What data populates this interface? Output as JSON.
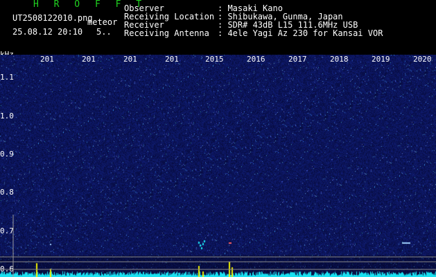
{
  "app": {
    "title": "H R O F F T",
    "filename": "UT2508122010.png",
    "mode": "meteor",
    "datetime": "25.08.12 20:10",
    "dt_extra": "5.."
  },
  "header": {
    "rows": [
      {
        "label": "Observer",
        "value": ": Masaki Kano"
      },
      {
        "label": "Receiving Location",
        "value": ": Shibukawa, Gunma, Japan"
      },
      {
        "label": "Receiver",
        "value": ": SDR# 43dB L15 111.6MHz USB"
      },
      {
        "label": "Receiving Antenna",
        "value": ": 4ele Yagi Az 230 for Kansai VOR"
      }
    ]
  },
  "axis": {
    "unit": "kHz",
    "y_ticks": [
      "1.1",
      "1.0",
      "0.9",
      "0.8",
      "0.7",
      "0.6"
    ],
    "y_range": [
      0.58,
      1.16
    ],
    "time_labels": [
      "201",
      "201",
      "201",
      "201",
      "2015",
      "2016",
      "2017",
      "2018",
      "2019",
      "2020"
    ]
  },
  "colors": {
    "background": "#070b48",
    "header_text": "#ffffff",
    "title": "#21d321",
    "signal": "#19e0f0",
    "peak": "#f0f000"
  }
}
